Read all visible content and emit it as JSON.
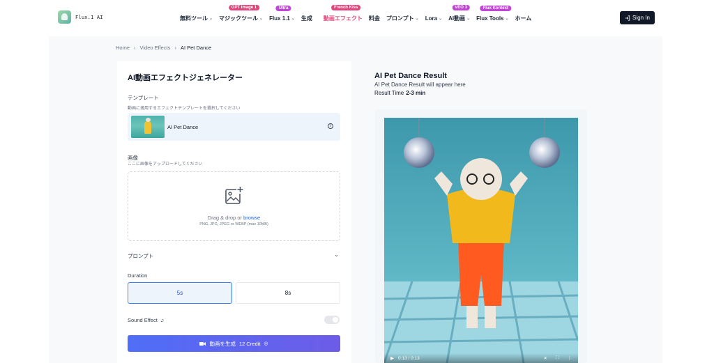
{
  "header": {
    "logo_text": "Flux.1 AI",
    "signin_label": "Sign In",
    "nav": [
      {
        "label": "無料ツール",
        "chevron": true,
        "badge": ""
      },
      {
        "label": "マジックツール",
        "chevron": true,
        "badge": "GPT Image 1"
      },
      {
        "label": "Flux 1.1",
        "chevron": true,
        "badge": "Ultra"
      },
      {
        "label": "生成",
        "chevron": false,
        "badge": ""
      },
      {
        "label": "動画エフェクト",
        "chevron": false,
        "badge": "French Kiss"
      },
      {
        "label": "料金",
        "chevron": false,
        "badge": ""
      },
      {
        "label": "プロンプト",
        "chevron": true,
        "badge": ""
      },
      {
        "label": "Lora",
        "chevron": true,
        "badge": ""
      },
      {
        "label": "AI動画",
        "chevron": true,
        "badge": "VEO 3"
      },
      {
        "label": "Flux Tools",
        "chevron": true,
        "badge": "Flux Kontext"
      },
      {
        "label": "ホーム",
        "chevron": false,
        "badge": ""
      }
    ]
  },
  "breadcrumb": {
    "home": "Home",
    "section": "Video Effects",
    "current": "AI Pet Dance"
  },
  "left": {
    "title": "AI動画エフェクトジェネレーター",
    "template_label": "テンプレート",
    "template_hint": "動画に適用するエフェクトテンプレートを選択してください",
    "template_name": "AI Pet Dance",
    "image_label": "画像",
    "image_hint": "ここに画像をアップロードしてください",
    "upload_text": "Drag & drop or",
    "upload_link": "browse",
    "upload_formats": "PNG, JPG, JPEG or WEBP (max 10MB)",
    "prompt_label": "プロンプト",
    "duration_label": "Duration",
    "duration_options": [
      "5s",
      "8s"
    ],
    "duration_selected": "5s",
    "sound_label": "Sound Effect",
    "sound_on": false,
    "generate_label": "動画を生成",
    "generate_credit": "12 Credit"
  },
  "right": {
    "title": "AI Pet Dance Result",
    "subtitle": "AI Pet Dance Result will appear here",
    "time_label": "Result Time",
    "time_value": "2-3 min",
    "video_time": "0:13 / 0:13"
  },
  "colors": {
    "accent": "#4f6ef7",
    "pink": "#e0457b",
    "purple": "#c046d6",
    "dark": "#111827"
  }
}
